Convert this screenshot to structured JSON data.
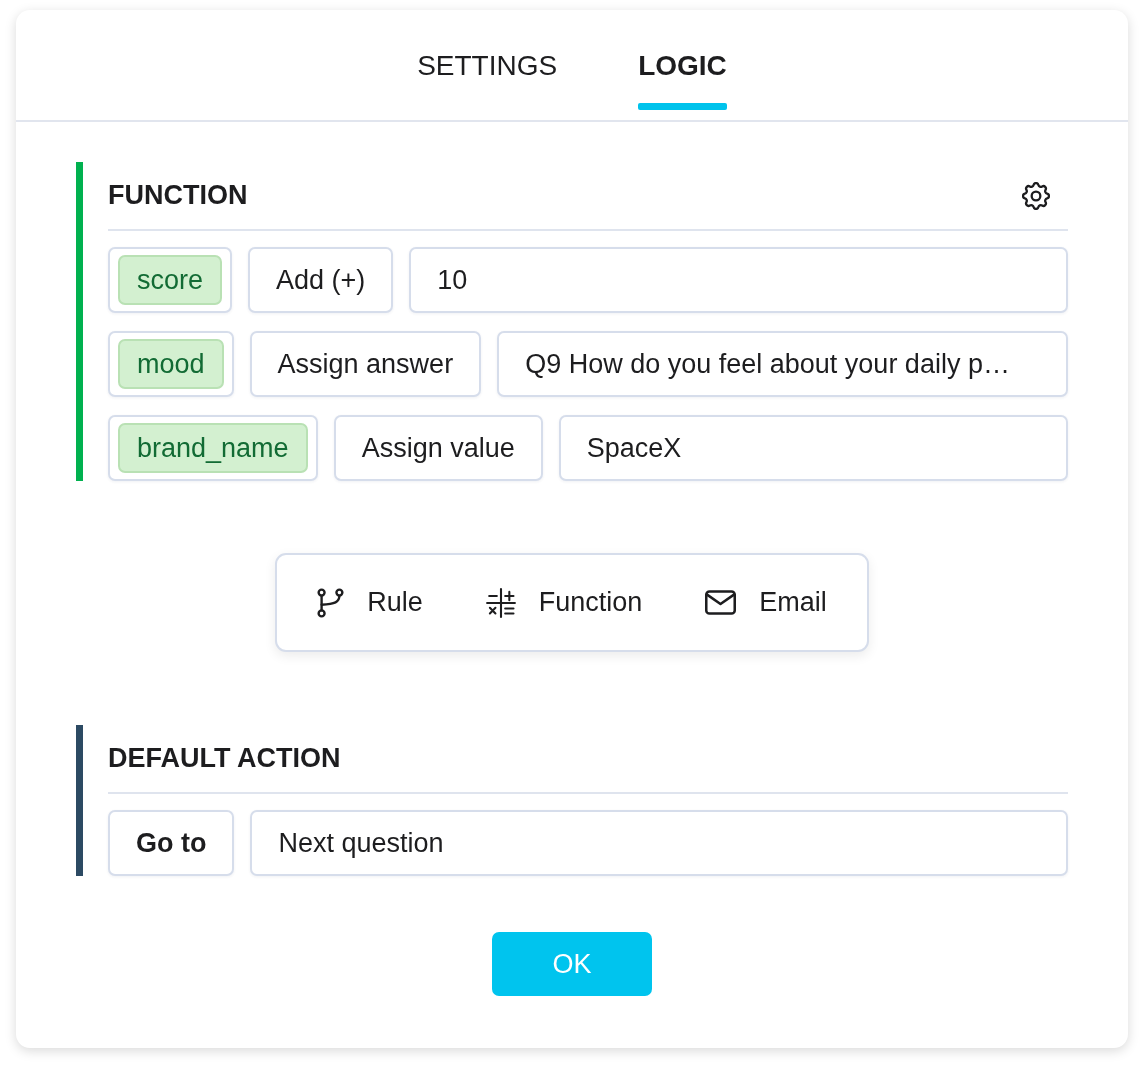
{
  "tabs": [
    {
      "label": "SETTINGS",
      "selected": false
    },
    {
      "label": "LOGIC",
      "selected": true
    }
  ],
  "function_block": {
    "title": "FUNCTION",
    "assignments": [
      {
        "variable": "score",
        "operation": "Add (+)",
        "value": "10"
      },
      {
        "variable": "mood",
        "operation": "Assign answer",
        "value": "Q9 How do you feel about your daily p…"
      },
      {
        "variable": "brand_name",
        "operation": "Assign value",
        "value": "SpaceX"
      }
    ]
  },
  "add_menu": {
    "items": [
      {
        "kind": "rule",
        "label": "Rule"
      },
      {
        "kind": "function",
        "label": "Function"
      },
      {
        "kind": "email",
        "label": "Email"
      }
    ]
  },
  "default_action": {
    "title": "DEFAULT ACTION",
    "action": "Go to",
    "target": "Next question"
  },
  "ok_button": "OK"
}
